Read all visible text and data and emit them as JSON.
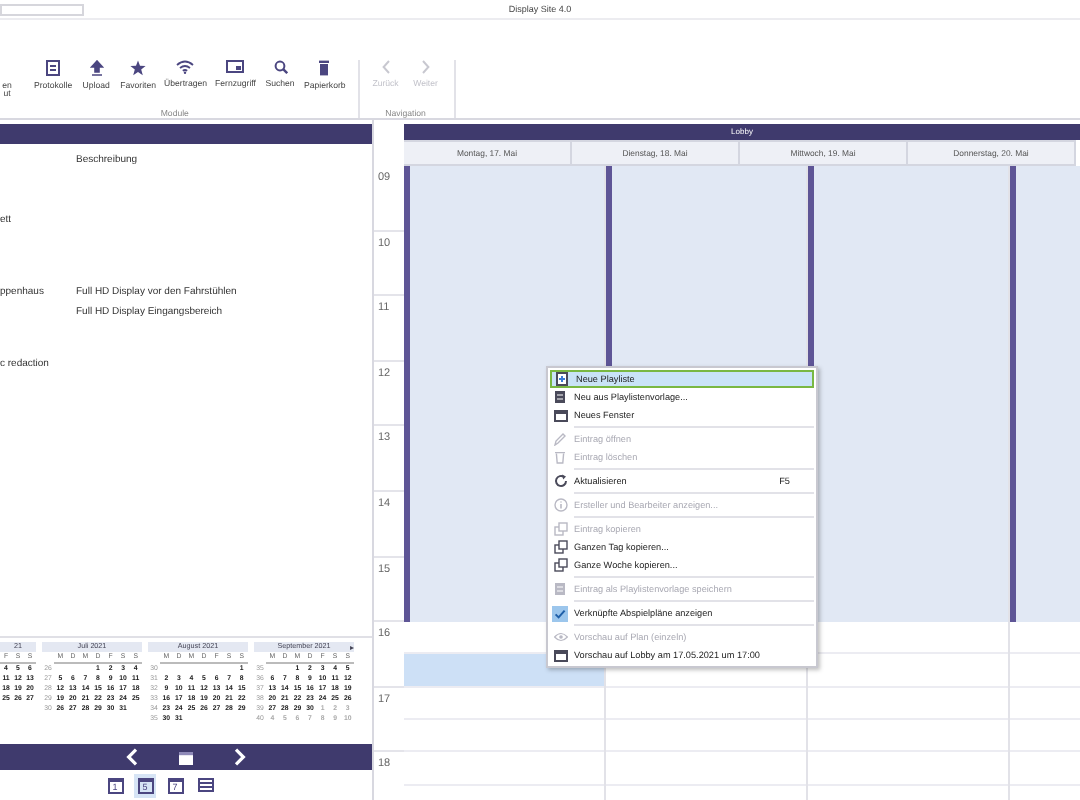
{
  "window": {
    "title": "Display Site 4.0"
  },
  "ribbon": {
    "groups": [
      {
        "label": "Module",
        "buttons": [
          {
            "label": "en\nut",
            "kind": "partial",
            "disabled": false
          },
          {
            "label": "Protokolle",
            "kind": "document",
            "disabled": false
          },
          {
            "label": "Upload",
            "kind": "upload",
            "disabled": false
          },
          {
            "label": "Favoriten",
            "kind": "star",
            "disabled": false
          },
          {
            "label": "Übertragen",
            "kind": "wifi",
            "disabled": false
          },
          {
            "label": "Fernzugriff",
            "kind": "monitor",
            "disabled": false
          },
          {
            "label": "Suchen",
            "kind": "search",
            "disabled": false
          },
          {
            "label": "Papierkorb",
            "kind": "trash",
            "disabled": false
          }
        ]
      },
      {
        "label": "Navigation",
        "buttons": [
          {
            "label": "Zurück",
            "kind": "back",
            "disabled": true
          },
          {
            "label": "Weiter",
            "kind": "forward",
            "disabled": true
          }
        ]
      }
    ]
  },
  "list": {
    "description_header": "Beschreibung",
    "rows": [
      {
        "name": "ett"
      },
      {
        "name": "ppenhaus",
        "descriptions": [
          "Full HD Display vor den Fahrstühlen",
          "Full HD Display Eingangsbereich"
        ]
      },
      {
        "name": "c redaction"
      }
    ]
  },
  "mini_calendar": {
    "next": "▸",
    "months": [
      {
        "title": "21",
        "weekdays": [
          "F",
          "S",
          "S"
        ],
        "weeks": [
          {
            "days": [
              "4",
              "5",
              "6"
            ]
          },
          {
            "days": [
              "11",
              "12",
              "13"
            ]
          },
          {
            "days": [
              "18",
              "19",
              "20"
            ]
          },
          {
            "days": [
              "25",
              "26",
              "27"
            ]
          }
        ]
      },
      {
        "title": "Juli 2021",
        "weekdays": [
          "M",
          "D",
          "M",
          "D",
          "F",
          "S",
          "S"
        ],
        "weeks": [
          {
            "number": "26",
            "days": [
              "1",
              "2",
              "3",
              "4"
            ]
          },
          {
            "number": "27",
            "days": [
              "5",
              "6",
              "7",
              "8",
              "9",
              "10",
              "11"
            ]
          },
          {
            "number": "28",
            "days": [
              "12",
              "13",
              "14",
              "15",
              "16",
              "17",
              "18"
            ]
          },
          {
            "number": "29",
            "days": [
              "19",
              "20",
              "21",
              "22",
              "23",
              "24",
              "25"
            ]
          },
          {
            "number": "30",
            "days": [
              "26",
              "27",
              "28",
              "29",
              "30",
              "31"
            ]
          }
        ]
      },
      {
        "title": "August 2021",
        "weekdays": [
          "M",
          "D",
          "M",
          "D",
          "F",
          "S",
          "S"
        ],
        "weeks": [
          {
            "number": "30",
            "days": [
              "1"
            ]
          },
          {
            "number": "31",
            "days": [
              "2",
              "3",
              "4",
              "5",
              "6",
              "7",
              "8"
            ]
          },
          {
            "number": "32",
            "days": [
              "9",
              "10",
              "11",
              "12",
              "13",
              "14",
              "15"
            ]
          },
          {
            "number": "33",
            "days": [
              "16",
              "17",
              "18",
              "19",
              "20",
              "21",
              "22"
            ]
          },
          {
            "number": "34",
            "days": [
              "23",
              "24",
              "25",
              "26",
              "27",
              "28",
              "29"
            ]
          },
          {
            "number": "35",
            "days": [
              "30",
              "31"
            ]
          }
        ]
      },
      {
        "title": "September 2021",
        "weekdays": [
          "M",
          "D",
          "M",
          "D",
          "F",
          "S",
          "S"
        ],
        "weeks": [
          {
            "number": "35",
            "days": [
              "1",
              "2",
              "3",
              "4",
              "5"
            ]
          },
          {
            "number": "36",
            "days": [
              "6",
              "7",
              "8",
              "9",
              "10",
              "11",
              "12"
            ]
          },
          {
            "number": "37",
            "days": [
              "13",
              "14",
              "15",
              "16",
              "17",
              "18",
              "19"
            ]
          },
          {
            "number": "38",
            "days": [
              "20",
              "21",
              "22",
              "23",
              "24",
              "25",
              "26"
            ]
          },
          {
            "number": "39",
            "days": [
              "27",
              "28",
              "29",
              "30"
            ],
            "next_days": [
              "1",
              "2",
              "3"
            ]
          },
          {
            "number": "40",
            "next_days": [
              "4",
              "5",
              "6",
              "7",
              "8",
              "9",
              "10"
            ]
          }
        ]
      }
    ]
  },
  "views": [
    {
      "kind": "day",
      "label": "1",
      "selected": false
    },
    {
      "kind": "week",
      "label": "5",
      "selected": true
    },
    {
      "kind": "week",
      "label": "7",
      "selected": false
    },
    {
      "kind": "list",
      "selected": false
    }
  ],
  "calendar": {
    "resource": "Lobby",
    "days": [
      {
        "label": "Montag, 17. Mai",
        "selected": true
      },
      {
        "label": "Dienstag, 18. Mai",
        "selected": false
      },
      {
        "label": "Mittwoch, 19. Mai",
        "selected": false
      },
      {
        "label": "Donnerstag, 20. Mai",
        "selected": false
      }
    ],
    "hours": [
      {
        "label": "09",
        "working": true,
        "selected": false
      },
      {
        "label": "10",
        "working": true,
        "selected": false
      },
      {
        "label": "11",
        "working": true,
        "selected": false
      },
      {
        "label": "12",
        "working": true,
        "selected": false
      },
      {
        "label": "13",
        "working": true,
        "selected": false
      },
      {
        "label": "14",
        "working": true,
        "selected": false
      },
      {
        "label": "15",
        "working": true,
        "selected": false
      },
      {
        "label": "16",
        "working": false,
        "selected": true
      },
      {
        "label": "17",
        "working": false,
        "selected": false
      },
      {
        "label": "18",
        "working": false,
        "selected": false
      }
    ]
  },
  "context_menu": [
    {
      "kind": "new",
      "label": "Neue Playliste",
      "disabled": false,
      "selected": true,
      "checked": false
    },
    {
      "kind": "template",
      "label": "Neu aus Playlistenvorlage...",
      "disabled": false,
      "selected": false,
      "checked": false
    },
    {
      "kind": "window",
      "label": "Neues Fenster",
      "disabled": false,
      "selected": false,
      "checked": false
    },
    {
      "kind": "separator"
    },
    {
      "kind": "edit",
      "label": "Eintrag öffnen",
      "disabled": true,
      "selected": false,
      "checked": false
    },
    {
      "kind": "trash",
      "label": "Eintrag löschen",
      "disabled": true,
      "selected": false,
      "checked": false
    },
    {
      "kind": "separator"
    },
    {
      "kind": "refresh",
      "label": "Aktualisieren",
      "shortcut": "F5",
      "disabled": false,
      "selected": false,
      "checked": false
    },
    {
      "kind": "separator"
    },
    {
      "kind": "info",
      "label": "Ersteller und Bearbeiter anzeigen...",
      "disabled": true,
      "selected": false,
      "checked": false
    },
    {
      "kind": "separator"
    },
    {
      "kind": "copy",
      "label": "Eintrag kopieren",
      "disabled": true,
      "selected": false,
      "checked": false
    },
    {
      "kind": "copy",
      "label": "Ganzen Tag kopieren...",
      "disabled": false,
      "selected": false,
      "checked": false
    },
    {
      "kind": "copy",
      "label": "Ganze Woche kopieren...",
      "disabled": false,
      "selected": false,
      "checked": false
    },
    {
      "kind": "separator"
    },
    {
      "kind": "template",
      "label": "Eintrag als Playlistenvorlage speichern",
      "disabled": true,
      "selected": false,
      "checked": false
    },
    {
      "kind": "separator"
    },
    {
      "kind": "toggle",
      "label": "Verknüpfte Abspielpläne anzeigen",
      "disabled": false,
      "selected": false,
      "checked": true
    },
    {
      "kind": "separator"
    },
    {
      "kind": "eye",
      "label": "Vorschau auf Plan (einzeln)",
      "disabled": true,
      "selected": false,
      "checked": false
    },
    {
      "kind": "window",
      "label": "Vorschau auf Lobby am 17.05.2021 um 17:00",
      "disabled": false,
      "selected": false,
      "checked": false
    }
  ]
}
